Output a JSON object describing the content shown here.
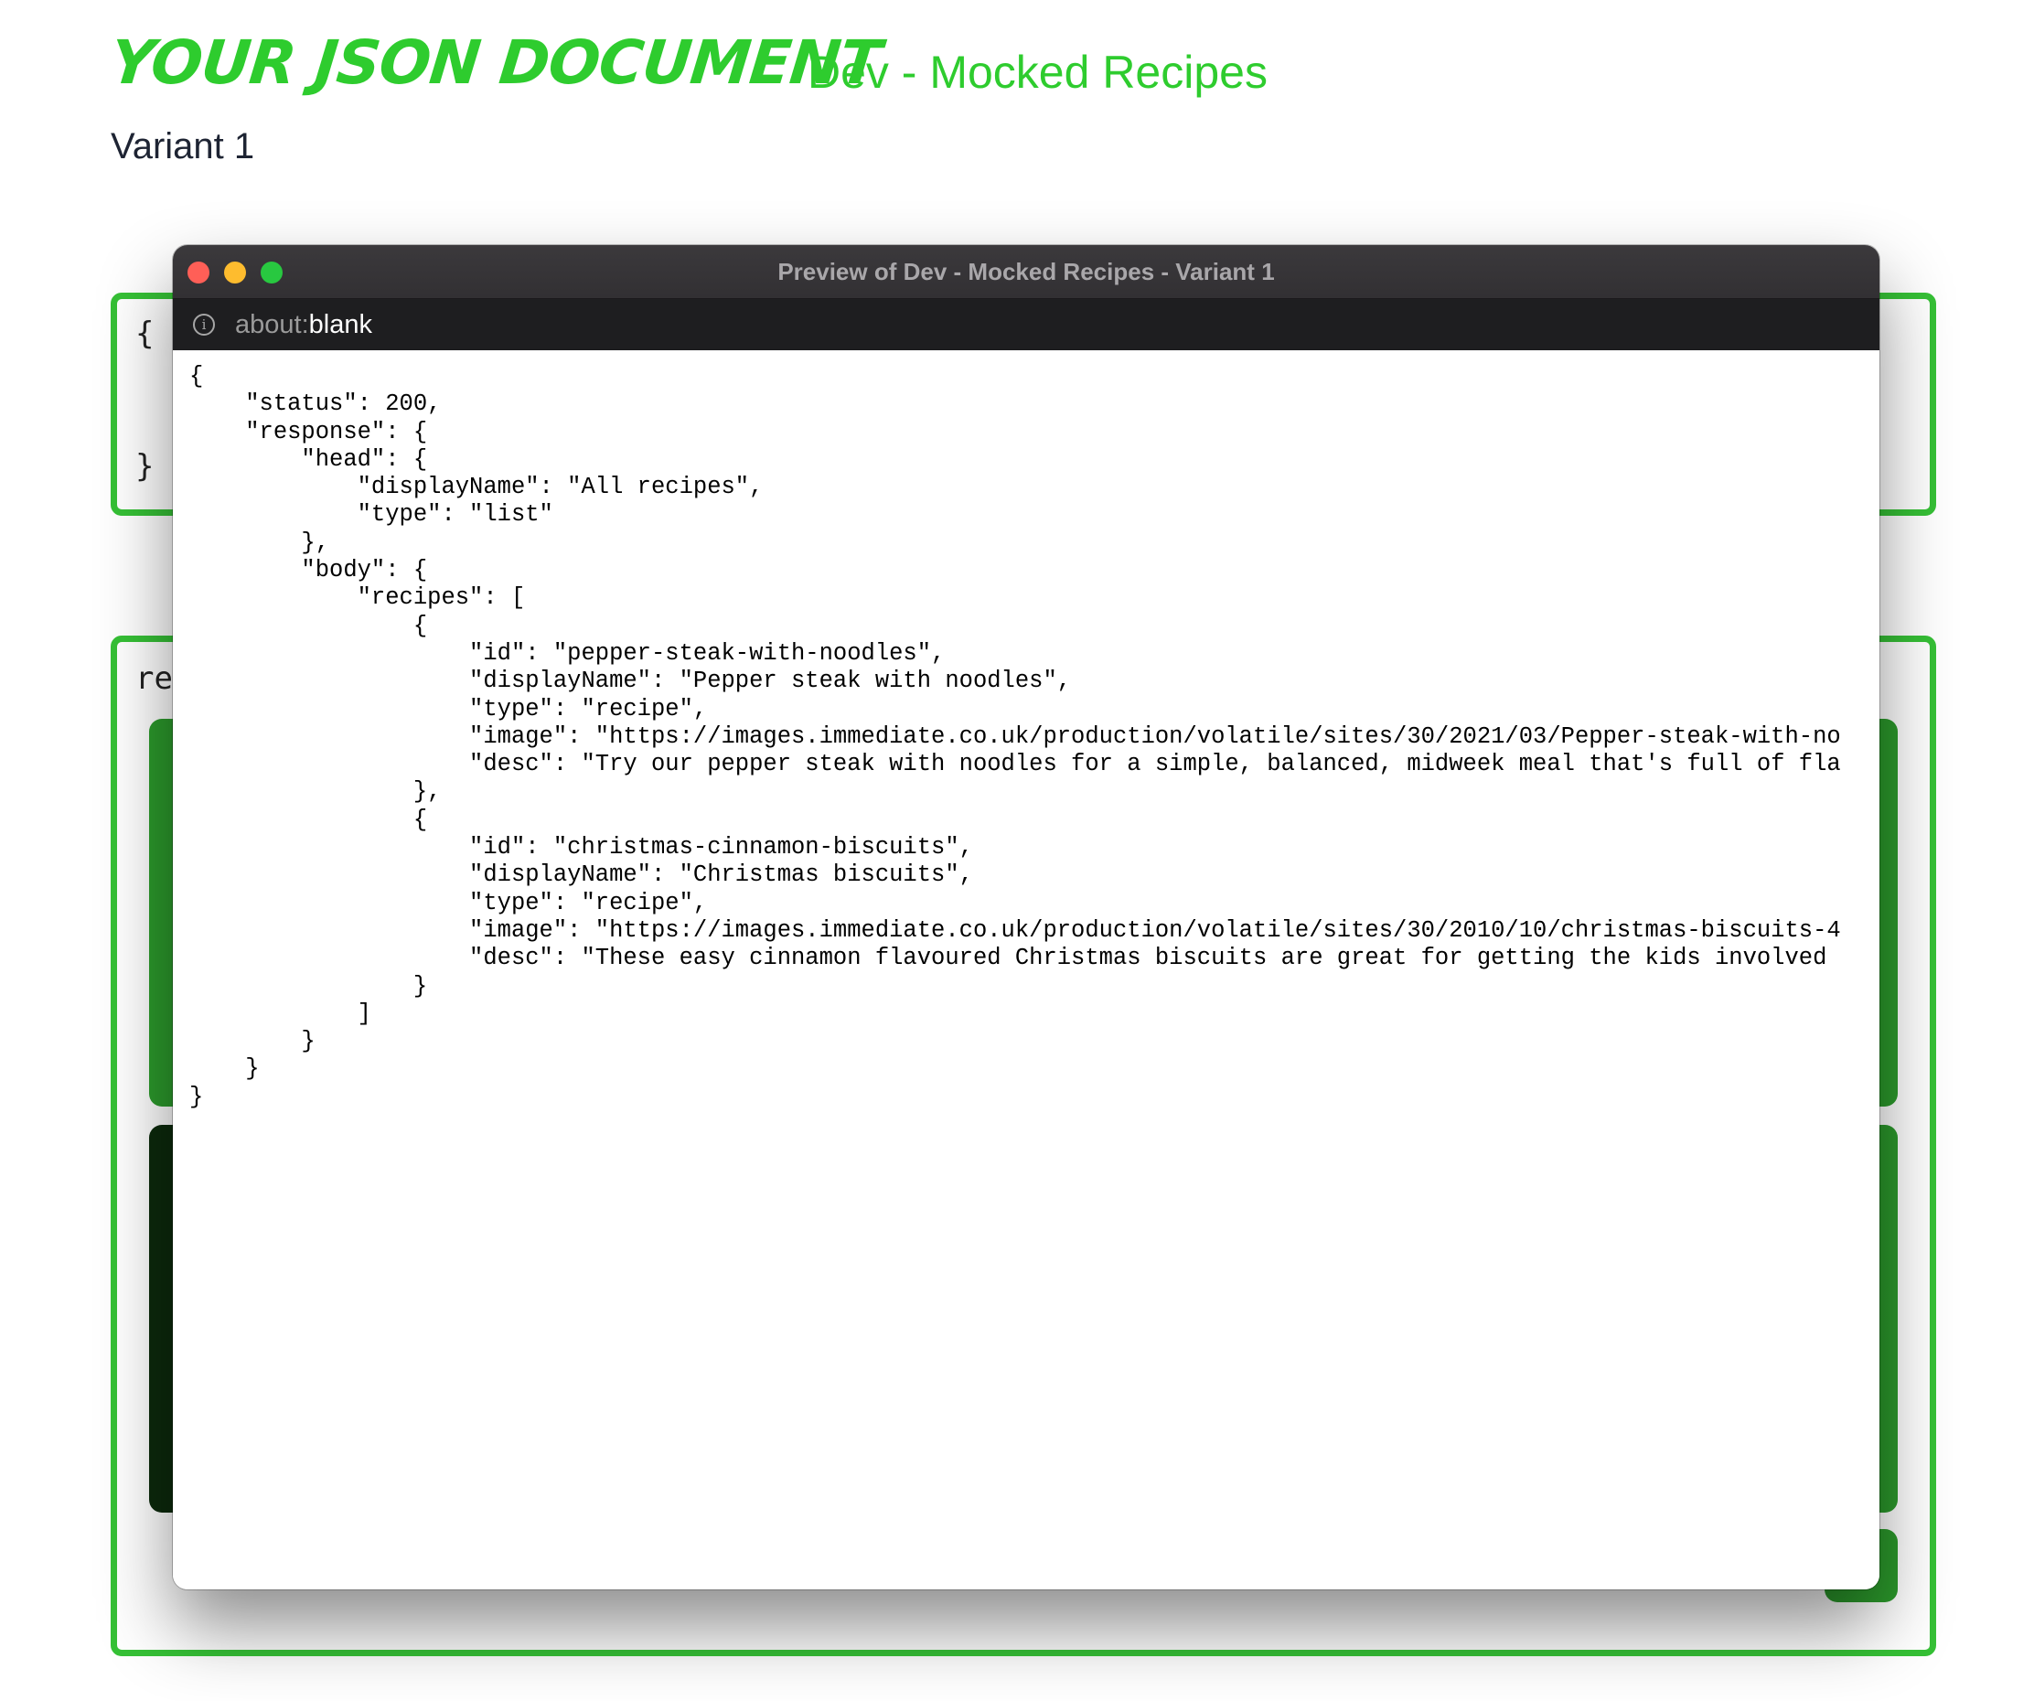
{
  "header": {
    "brand": "YOUR JSON DOCUMENT",
    "document_name": "Dev - Mocked Recipes",
    "variant": "Variant 1"
  },
  "background": {
    "brace_open": "{",
    "brace_close": "}",
    "truncated_key": "re"
  },
  "preview_window": {
    "title": "Preview of Dev - Mocked Recipes - Variant 1",
    "url_scheme": "about:",
    "url_path": "blank",
    "info_icon": "info-icon",
    "json_text": "{\n    \"status\": 200,\n    \"response\": {\n        \"head\": {\n            \"displayName\": \"All recipes\",\n            \"type\": \"list\"\n        },\n        \"body\": {\n            \"recipes\": [\n                {\n                    \"id\": \"pepper-steak-with-noodles\",\n                    \"displayName\": \"Pepper steak with noodles\",\n                    \"type\": \"recipe\",\n                    \"image\": \"https://images.immediate.co.uk/production/volatile/sites/30/2021/03/Pepper-steak-with-no\n                    \"desc\": \"Try our pepper steak with noodles for a simple, balanced, midweek meal that's full of fla\n                },\n                {\n                    \"id\": \"christmas-cinnamon-biscuits\",\n                    \"displayName\": \"Christmas biscuits\",\n                    \"type\": \"recipe\",\n                    \"image\": \"https://images.immediate.co.uk/production/volatile/sites/30/2010/10/christmas-biscuits-4\n                    \"desc\": \"These easy cinnamon flavoured Christmas biscuits are great for getting the kids involved\n                }\n            ]\n        }\n    }\n}"
  },
  "colors": {
    "accent_green": "#2ecc2e",
    "panel_green": "#36c136",
    "titlebar": "#363437",
    "addressbar": "#1e1e20",
    "close": "#ff5f57",
    "minimize": "#febc2e",
    "maximize": "#28c840"
  }
}
